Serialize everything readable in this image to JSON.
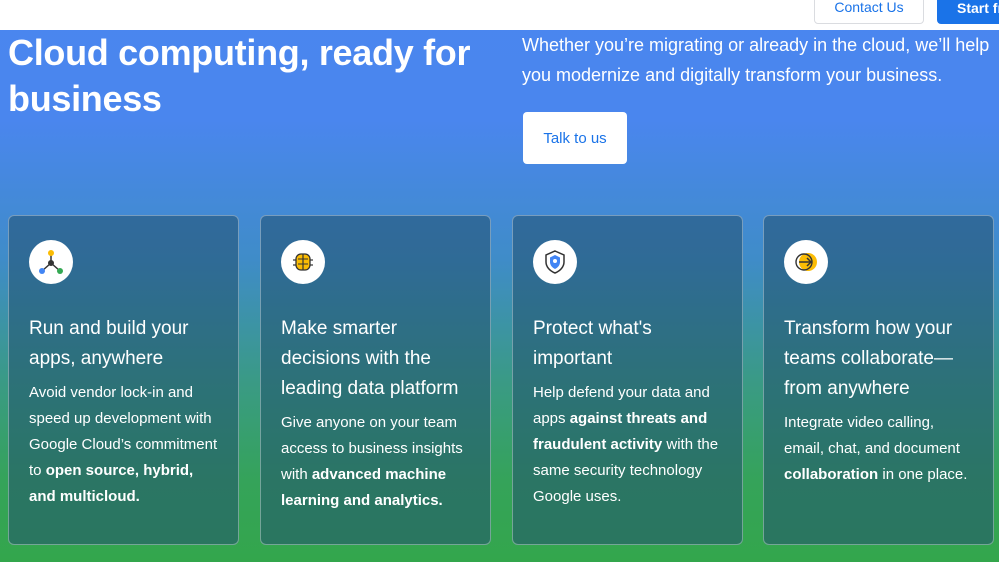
{
  "header": {
    "contact_label": "Contact Us",
    "start_label": "Start fr"
  },
  "hero": {
    "title": "Cloud computing, ready for business",
    "description": "Whether you’re migrating or already in the cloud, we’ll help you modernize and digitally transform your business.",
    "cta_label": "Talk to us"
  },
  "cards": [
    {
      "icon": "nodes-icon",
      "title": "Run and build your apps, anywhere",
      "text_a": "Avoid vendor lock-in and speed up development with Google Cloud’s commitment to ",
      "text_b": "open source, hybrid, and multicloud.",
      "text_c": ""
    },
    {
      "icon": "brain-chip-icon",
      "title": "Make smarter decisions with the leading data platform",
      "text_a": "Give anyone on your team access to business insights with ",
      "text_b": "advanced machine learning and analytics.",
      "text_c": ""
    },
    {
      "icon": "shield-icon",
      "title": "Protect what's important",
      "text_a": "Help defend your data and apps ",
      "text_b": "against threats and fraudulent activity",
      "text_c": " with the same security technology Google uses."
    },
    {
      "icon": "collaborate-arrow-icon",
      "title": "Transform how your teams collaborate—from anywhere",
      "text_a": "Integrate video calling, email, chat, and document ",
      "text_b": "collaboration",
      "text_c": " in one place."
    }
  ],
  "colors": {
    "accent": "#1a73e8",
    "icon_yellow": "#fbbc04",
    "icon_green": "#34a853",
    "icon_red": "#ea4335",
    "icon_blue": "#4285f4"
  }
}
